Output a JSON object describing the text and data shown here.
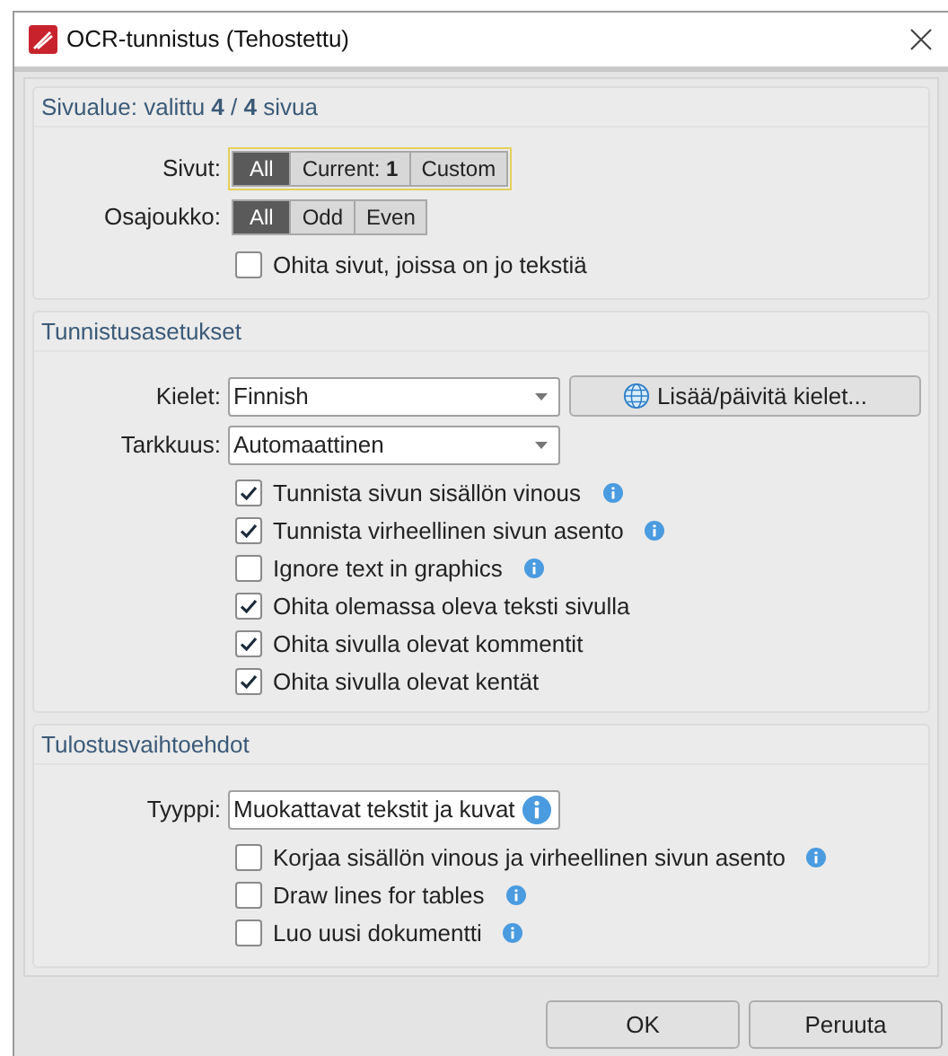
{
  "window": {
    "title": "OCR-tunnistus (Tehostettu)"
  },
  "page_range": {
    "header": "Sivualue: valittu **4** / **4** sivua",
    "pages": {
      "label": "Sivut:",
      "focused": true,
      "options": [
        {
          "label": "All",
          "selected": true
        },
        {
          "label": "Current: **1**",
          "selected": false
        },
        {
          "label": "Custom",
          "selected": false
        }
      ]
    },
    "subset": {
      "label": "Osajoukko:",
      "options": [
        {
          "label": "All",
          "selected": true
        },
        {
          "label": "Odd",
          "selected": false
        },
        {
          "label": "Even",
          "selected": false
        }
      ]
    },
    "skip_pages": {
      "label": "Ohita sivut, joissa on jo tekstiä",
      "checked": false
    }
  },
  "recognition": {
    "header": "Tunnistusasetukset",
    "languages": {
      "label": "Kielet:",
      "value": "Finnish"
    },
    "update_button": "Lisää/päivitä kielet...",
    "accuracy": {
      "label": "Tarkkuus:",
      "value": "Automaattinen"
    },
    "options": [
      {
        "label": "Tunnista sivun sisällön vinous",
        "checked": true,
        "info": true
      },
      {
        "label": "Tunnista virheellinen sivun asento",
        "checked": true,
        "info": true
      },
      {
        "label": "Ignore text in graphics",
        "checked": false,
        "info": true
      },
      {
        "label": "Ohita olemassa oleva teksti sivulla",
        "checked": true,
        "info": false
      },
      {
        "label": "Ohita sivulla olevat kommentit",
        "checked": true,
        "info": false
      },
      {
        "label": "Ohita sivulla olevat kentät",
        "checked": true,
        "info": false
      }
    ]
  },
  "output": {
    "header": "Tulostusvaihtoehdot",
    "type": {
      "label": "Tyyppi:",
      "value": "Muokattavat tekstit ja kuvat",
      "info": true
    },
    "options": [
      {
        "label": "Korjaa sisällön vinous ja virheellinen sivun asento",
        "checked": false,
        "info": true
      },
      {
        "label": "Draw lines for tables",
        "checked": false,
        "info": true
      },
      {
        "label": "Luo uusi dokumentti",
        "checked": false,
        "info": true
      }
    ]
  },
  "buttons": [
    "OK",
    "Peruuta"
  ]
}
